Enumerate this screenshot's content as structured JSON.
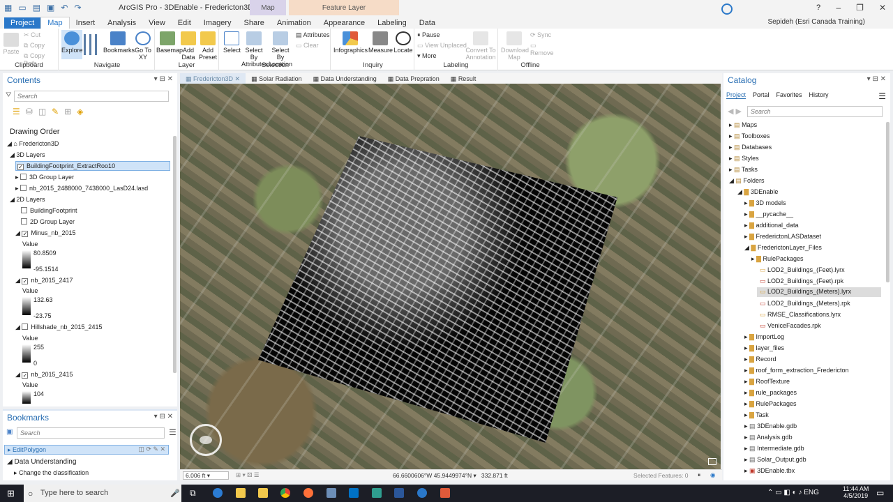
{
  "window": {
    "title": "ArcGIS Pro - 3DEnable - Fredericton3D",
    "context_map": "Map",
    "context_feature": "Feature Layer",
    "help": "?"
  },
  "tabs": [
    "Project",
    "Map",
    "Insert",
    "Analysis",
    "View",
    "Edit",
    "Imagery",
    "Share",
    "Animation",
    "Appearance",
    "Labeling",
    "Data"
  ],
  "user": "Sepideh (Esri Canada Training)",
  "ribbon": {
    "clipboard": {
      "paste": "Paste",
      "cut": "Cut",
      "copy": "Copy",
      "copy_path": "Copy Path",
      "label": "Clipboard"
    },
    "navigate": {
      "explore": "Explore",
      "bookmarks": "Bookmarks",
      "goto": "Go To XY",
      "label": "Navigate"
    },
    "layer": {
      "basemap": "Basemap",
      "add_data": "Add Data",
      "add_preset": "Add Preset",
      "label": "Layer"
    },
    "selection": {
      "select": "Select",
      "by_attr": "Select By Attributes",
      "by_loc": "Select By Location",
      "attributes": "Attributes",
      "clear": "Clear",
      "label": "Selection"
    },
    "inquiry": {
      "infographics": "Infographics",
      "measure": "Measure",
      "locate": "Locate",
      "label": "Inquiry"
    },
    "labeling": {
      "pause": "Pause",
      "view_unplaced": "View Unplaced",
      "more": "More",
      "convert": "Convert To Annotation",
      "label": "Labeling"
    },
    "offline": {
      "download": "Download Map",
      "sync": "Sync",
      "remove": "Remove",
      "label": "Offline"
    }
  },
  "contents": {
    "title": "Contents",
    "search_placeholder": "Search",
    "drawing_order": "Drawing Order",
    "map_name": "Fredericton3D",
    "layers_3d": "3D Layers",
    "layers_2d": "2D Layers",
    "items": [
      "BuildingFootprint_ExtractRoo10",
      "3D Group Layer",
      "nb_2015_2488000_7438000_LasD24.lasd",
      "BuildingFootprint",
      "2D Group Layer",
      "Minus_nb_2015",
      "nb_2015_2417",
      "Hillshade_nb_2015_2415",
      "nb_2015_2415"
    ],
    "value_label": "Value",
    "legends": [
      {
        "high": "80.8509",
        "low": "-95.1514"
      },
      {
        "high": "132.63",
        "low": "-23.75"
      },
      {
        "high": "255",
        "low": "0"
      },
      {
        "high": "104",
        "low": ""
      }
    ]
  },
  "bookmarks": {
    "title": "Bookmarks",
    "search_placeholder": "Search",
    "items": [
      "EditPolygon",
      "Data Understanding",
      "Change the classification"
    ]
  },
  "map_tabs": [
    "Fredericton3D",
    "Solar Radiation",
    "Data Understanding",
    "Data Prepration",
    "Result"
  ],
  "map_status": {
    "scale": "6,006 ft",
    "coords": "66.6600606°W 45.9449974°N",
    "elevation": "332.871 ft",
    "selected": "Selected Features: 0"
  },
  "catalog": {
    "title": "Catalog",
    "tabs": [
      "Project",
      "Portal",
      "Favorites",
      "History"
    ],
    "search_placeholder": "Search",
    "top": [
      "Maps",
      "Toolboxes",
      "Databases",
      "Styles",
      "Tasks",
      "Folders"
    ],
    "folder_root": "3DEnable",
    "items": [
      "3D models",
      "__pycache__",
      "additional_data",
      "FrederictonLASDataset",
      "FrederictonLayer_Files",
      "RulePackages",
      "LOD2_Buildings_(Feet).lyrx",
      "LOD2_Buildings_(Feet).rpk",
      "LOD2_Buildings_(Meters).lyrx",
      "LOD2_Buildings_(Meters).rpk",
      "RMSE_Classifications.lyrx",
      "VeniceFacades.rpk",
      "ImportLog",
      "layer_files",
      "Record",
      "roof_form_extraction_Fredericton",
      "RoofTexture",
      "rule_packages",
      "RulePackages",
      "Task",
      "3DEnable.gdb",
      "Analysis.gdb",
      "Intermediate.gdb",
      "Solar_Output.gdb",
      "3DEnable.tbx"
    ]
  },
  "taskbar": {
    "search_placeholder": "Type here to search",
    "time": "11:44 AM",
    "date": "4/5/2019"
  },
  "colors": {
    "accent": "#2a78c9",
    "selection": "#cfe3f8"
  }
}
